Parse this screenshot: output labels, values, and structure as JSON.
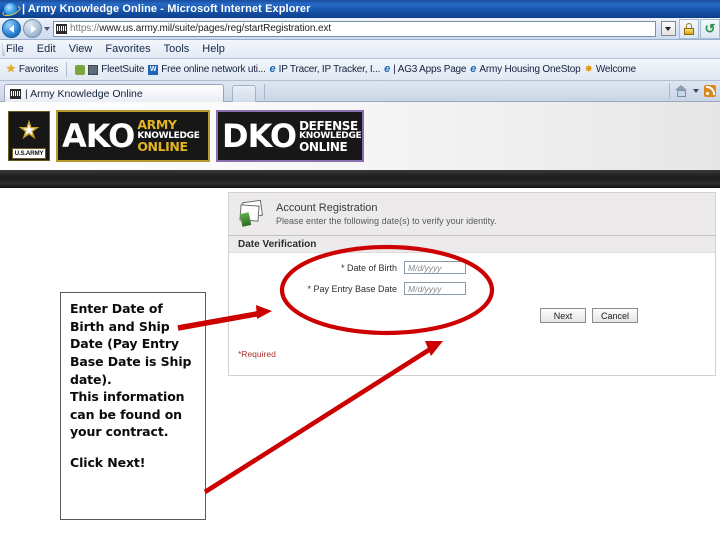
{
  "window": {
    "title": "| Army Knowledge Online - Microsoft Internet Explorer",
    "browser_icon": "internet-explorer-icon"
  },
  "address_bar": {
    "back_icon": "back-arrow-icon",
    "forward_icon": "forward-arrow-icon",
    "history_icon": "chevron-down-icon",
    "site_icon": "page-favicon",
    "url": "https://www.us.army.mil/suite/pages/reg/startRegistration.ext",
    "url_scheme": "https://",
    "url_rest": "www.us.army.mil/suite/pages/reg/startRegistration.ext",
    "dropdown_icon": "address-dropdown-icon",
    "security_icon": "lock-icon",
    "refresh_icon": "refresh-icon"
  },
  "menu": {
    "items": [
      {
        "label": "File"
      },
      {
        "label": "Edit"
      },
      {
        "label": "View"
      },
      {
        "label": "Favorites"
      },
      {
        "label": "Tools"
      },
      {
        "label": "Help"
      }
    ]
  },
  "favorites_bar": {
    "favorites_label": "Favorites",
    "favorites_icon": "star-icon",
    "items": [
      {
        "label": "FleetSuite",
        "icon": "green-page-icon"
      },
      {
        "label": "Free online network uti...",
        "icon": "blue-square-icon"
      },
      {
        "label": "IP Tracer, IP Tracker, I...",
        "icon": "ie-page-icon"
      },
      {
        "label": "| AG3 Apps Page",
        "icon": "ie-page-icon"
      },
      {
        "label": "Army Housing OneStop",
        "icon": "ie-page-icon"
      },
      {
        "label": "Welcome",
        "icon": "sun-icon"
      }
    ]
  },
  "tab_bar": {
    "tabs": [
      {
        "label": "| Army Knowledge Online",
        "icon": "page-favicon"
      }
    ],
    "new_tab_label": "",
    "home_icon": "home-icon",
    "home_caret_icon": "chevron-down-icon",
    "feeds_icon": "rss-feed-icon"
  },
  "page": {
    "logos": {
      "seal_icon": "us-army-star-seal-icon",
      "seal_label": "U.S.ARMY",
      "ako": {
        "acronym": "AKO",
        "line1": "ARMY",
        "line2": "KNOWLEDGE",
        "line3": "ONLINE"
      },
      "dko": {
        "acronym": "DKO",
        "line1": "DEFENSE",
        "line2": "KNOWLEDGE",
        "line3": "ONLINE"
      }
    },
    "registration": {
      "panel_icon": "registration-pages-icon",
      "title": "Account Registration",
      "subtitle": "Please enter the following date(s) to verify your identity.",
      "section_title": "Date Verification",
      "fields": [
        {
          "label": "* Date of Birth",
          "value": "",
          "placeholder": "M/d/yyyy"
        },
        {
          "label": "* Pay Entry Base Date",
          "value": "",
          "placeholder": "M/d/yyyy"
        }
      ],
      "buttons": [
        {
          "label": "Next"
        },
        {
          "label": "Cancel"
        }
      ],
      "required_note": "*Required"
    }
  },
  "annotation": {
    "accent_color": "#cc0000",
    "ellipse_name": "red-highlight-ellipse",
    "arrow_to_fields": "red-arrow-to-date-fields",
    "arrow_to_next": "red-arrow-to-next-button",
    "callout_lines": [
      "Enter Date of",
      "Birth and Ship",
      "Date (Pay Entry",
      "Base Date is Ship",
      "date).",
      "This information",
      "can be found on",
      "your contract."
    ],
    "callout_line_1": "Enter Date of",
    "callout_line_2": "Birth and Ship",
    "callout_line_3": "Date (Pay Entry",
    "callout_line_4": "Base Date is Ship",
    "callout_line_5": "date).",
    "callout_line_6": "This information",
    "callout_line_7": "can be found on",
    "callout_line_8": "your contract.",
    "callout_cta": "Click Next!"
  }
}
